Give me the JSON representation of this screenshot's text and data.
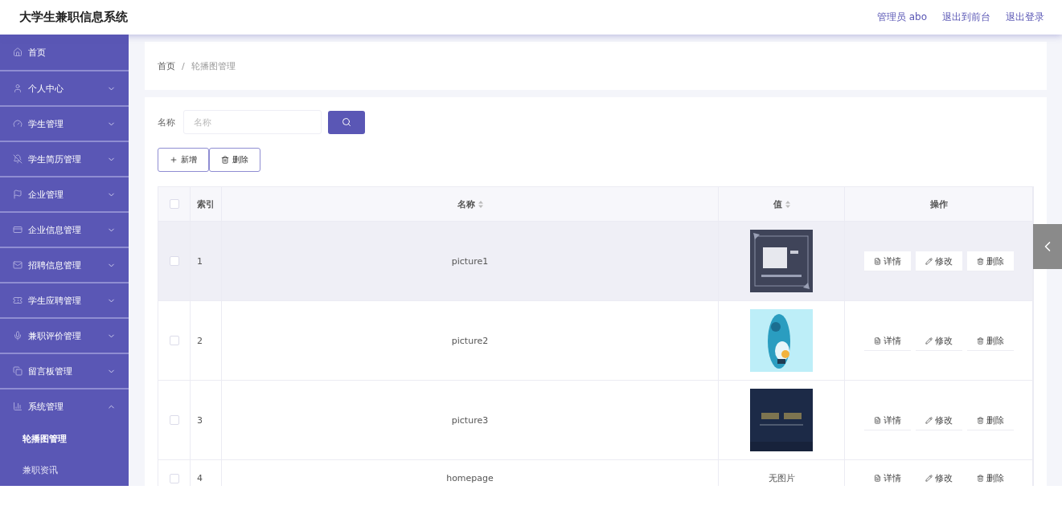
{
  "header": {
    "title": "大学生兼职信息系统",
    "links": [
      "管理员 abo",
      "退出到前台",
      "退出登录"
    ]
  },
  "sidebar": {
    "items": [
      {
        "kind": "link",
        "label": "首页"
      },
      {
        "kind": "menu",
        "label": "个人中心",
        "expanded": false
      },
      {
        "kind": "menu",
        "label": "学生管理",
        "expanded": false
      },
      {
        "kind": "menu",
        "label": "学生简历管理",
        "expanded": false
      },
      {
        "kind": "menu",
        "label": "企业管理",
        "expanded": false
      },
      {
        "kind": "menu",
        "label": "企业信息管理",
        "expanded": false
      },
      {
        "kind": "menu",
        "label": "招聘信息管理",
        "expanded": false
      },
      {
        "kind": "menu",
        "label": "学生应聘管理",
        "expanded": false
      },
      {
        "kind": "menu",
        "label": "兼职评价管理",
        "expanded": false
      },
      {
        "kind": "menu",
        "label": "留言板管理",
        "expanded": false
      },
      {
        "kind": "menu",
        "label": "系统管理",
        "expanded": true,
        "children": [
          {
            "label": "轮播图管理",
            "selected": true
          },
          {
            "label": "兼职资讯",
            "selected": false
          }
        ]
      }
    ]
  },
  "breadcrumb": {
    "separator": "/",
    "items": [
      "首页",
      "轮播图管理"
    ]
  },
  "search": {
    "label": "名称",
    "placeholder": "名称"
  },
  "toolbar": [
    "新增",
    "删除"
  ],
  "table": {
    "select_all_checked": false,
    "columns": [
      {
        "label": "索引",
        "sortable": false
      },
      {
        "label": "名称",
        "sortable": true
      },
      {
        "label": "值",
        "sortable": true
      },
      {
        "label": "操作",
        "sortable": false
      }
    ],
    "rows": [
      {
        "index": "1",
        "name": "picture1",
        "value": {
          "kind": "picture"
        },
        "checked": false,
        "highlighted": true,
        "actions": [
          "详情",
          "修改",
          "删除"
        ]
      },
      {
        "index": "2",
        "name": "picture2",
        "value": {
          "kind": "picture"
        },
        "checked": false,
        "highlighted": false,
        "actions": [
          "详情",
          "修改",
          "删除"
        ]
      },
      {
        "index": "3",
        "name": "picture3",
        "value": {
          "kind": "picture"
        },
        "checked": false,
        "highlighted": false,
        "actions": [
          "详情",
          "修改",
          "删除"
        ]
      },
      {
        "index": "4",
        "name": "homepage",
        "value": {
          "kind": "text",
          "text": "无图片"
        },
        "checked": false,
        "highlighted": false,
        "actions": [
          "详情",
          "修改",
          "删除"
        ]
      }
    ]
  }
}
